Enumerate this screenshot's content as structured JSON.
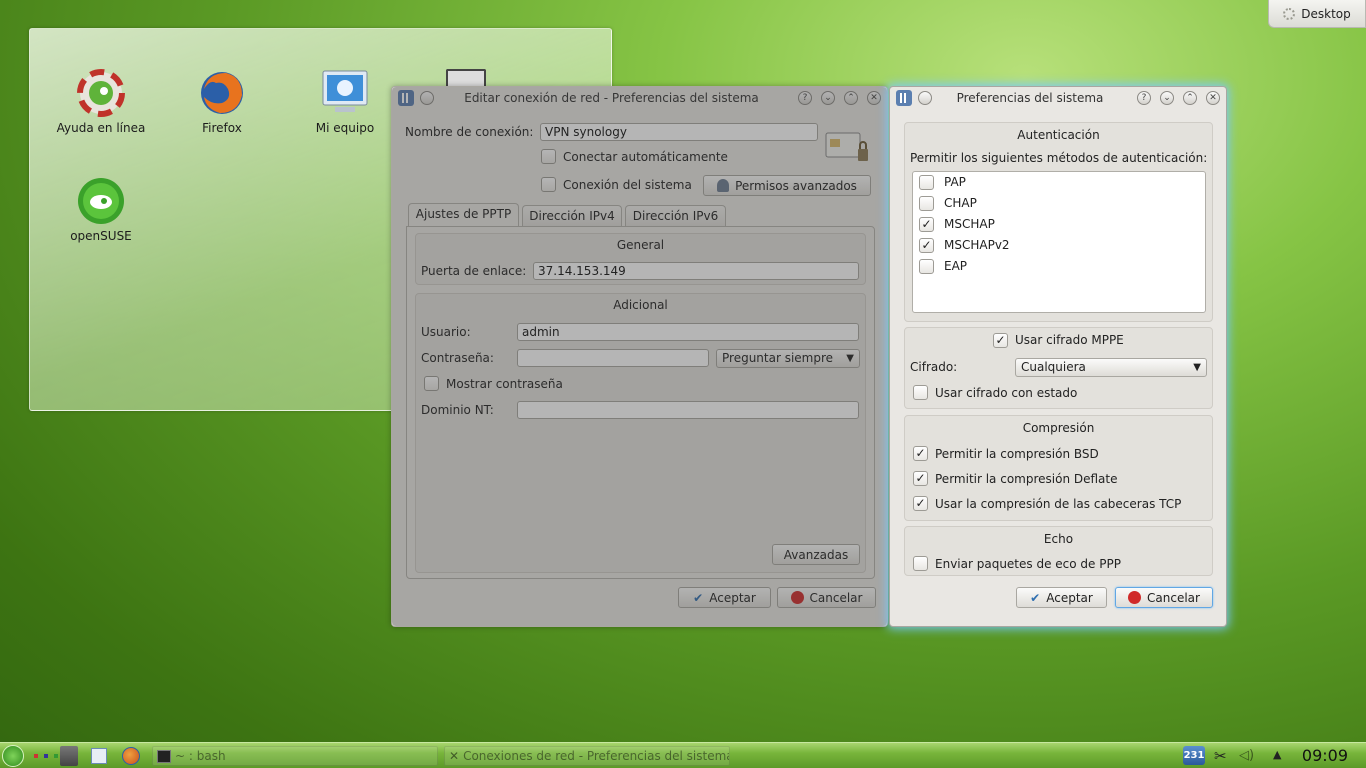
{
  "desktop_button": {
    "label": "Desktop"
  },
  "desktop_icons": [
    {
      "label": "Ayuda en línea",
      "icon": "help-lifebuoy-icon"
    },
    {
      "label": "Firefox",
      "icon": "firefox-icon"
    },
    {
      "label": "Mi equipo",
      "icon": "computer-icon"
    },
    {
      "label": "openSUSE",
      "icon": "opensuse-icon"
    }
  ],
  "editor": {
    "title": "Editar conexión de red - Preferencias del sistema",
    "connection_name_label": "Nombre de conexión:",
    "connection_name_value": "VPN synology",
    "auto_connect_label": "Conectar automáticamente",
    "system_conn_label": "Conexión del sistema",
    "advanced_perms_label": "Permisos avanzados",
    "tabs": [
      "Ajustes de PPTP",
      "Dirección IPv4",
      "Dirección IPv6"
    ],
    "general_title": "General",
    "gateway_label": "Puerta de enlace:",
    "gateway_value": "37.14.153.149",
    "additional_title": "Adicional",
    "user_label": "Usuario:",
    "user_value": "admin",
    "password_label": "Contraseña:",
    "password_value": "",
    "password_mode": "Preguntar siempre",
    "show_password_label": "Mostrar contraseña",
    "nt_domain_label": "Dominio NT:",
    "nt_domain_value": "",
    "advanced_button": "Avanzadas",
    "ok_button": "Aceptar",
    "cancel_button": "Cancelar"
  },
  "prefs": {
    "title": "Preferencias del sistema",
    "auth_title": "Autenticación",
    "auth_methods_label": "Permitir los siguientes métodos de autenticación:",
    "auth_methods": [
      {
        "label": "PAP",
        "checked": false
      },
      {
        "label": "CHAP",
        "checked": false
      },
      {
        "label": "MSCHAP",
        "checked": true
      },
      {
        "label": "MSCHAPv2",
        "checked": true
      },
      {
        "label": "EAP",
        "checked": false
      }
    ],
    "mppe_label": "Usar cifrado MPPE",
    "mppe_checked": true,
    "cipher_label": "Cifrado:",
    "cipher_value": "Cualquiera",
    "stateful_label": "Usar cifrado con estado",
    "stateful_checked": false,
    "compression_title": "Compresión",
    "compression_opts": [
      {
        "label": "Permitir la compresión BSD",
        "checked": true
      },
      {
        "label": "Permitir la compresión Deflate",
        "checked": true
      },
      {
        "label": "Usar la compresión de las cabeceras TCP",
        "checked": true
      }
    ],
    "echo_title": "Echo",
    "echo_label": "Enviar paquetes de eco de PPP",
    "echo_checked": false,
    "ok_button": "Aceptar",
    "cancel_button": "Cancelar"
  },
  "taskbar": {
    "tasks": [
      {
        "label": "~ : bash"
      },
      {
        "label": "Conexiones de red - Preferencias del sistema"
      }
    ],
    "updates_badge": "231",
    "clock": "09:09"
  },
  "colors": {
    "accent": "#61a7e4",
    "desktop_green": "#5b9a25"
  }
}
